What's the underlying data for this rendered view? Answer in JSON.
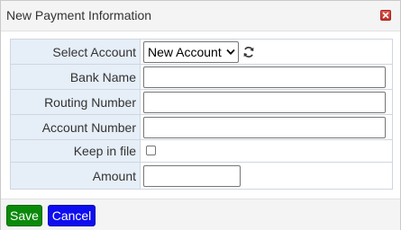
{
  "dialog": {
    "title": "New Payment Information"
  },
  "form": {
    "select_account": {
      "label": "Select Account",
      "selected": "New Account"
    },
    "bank_name": {
      "label": "Bank Name",
      "value": ""
    },
    "routing_number": {
      "label": "Routing Number",
      "value": ""
    },
    "account_number": {
      "label": "Account Number",
      "value": ""
    },
    "keep_in_file": {
      "label": "Keep in file",
      "checked": false
    },
    "amount": {
      "label": "Amount",
      "value": ""
    }
  },
  "footer": {
    "save_label": "Save",
    "cancel_label": "Cancel"
  },
  "colors": {
    "label_bg": "#e6eef8",
    "save_bg": "#0a8a0a",
    "cancel_bg": "#0d0df0",
    "close_bg": "#d0453d"
  },
  "icons": {
    "close": "close-icon",
    "refresh": "refresh-icon",
    "dropdown": "chevron-down-icon"
  }
}
